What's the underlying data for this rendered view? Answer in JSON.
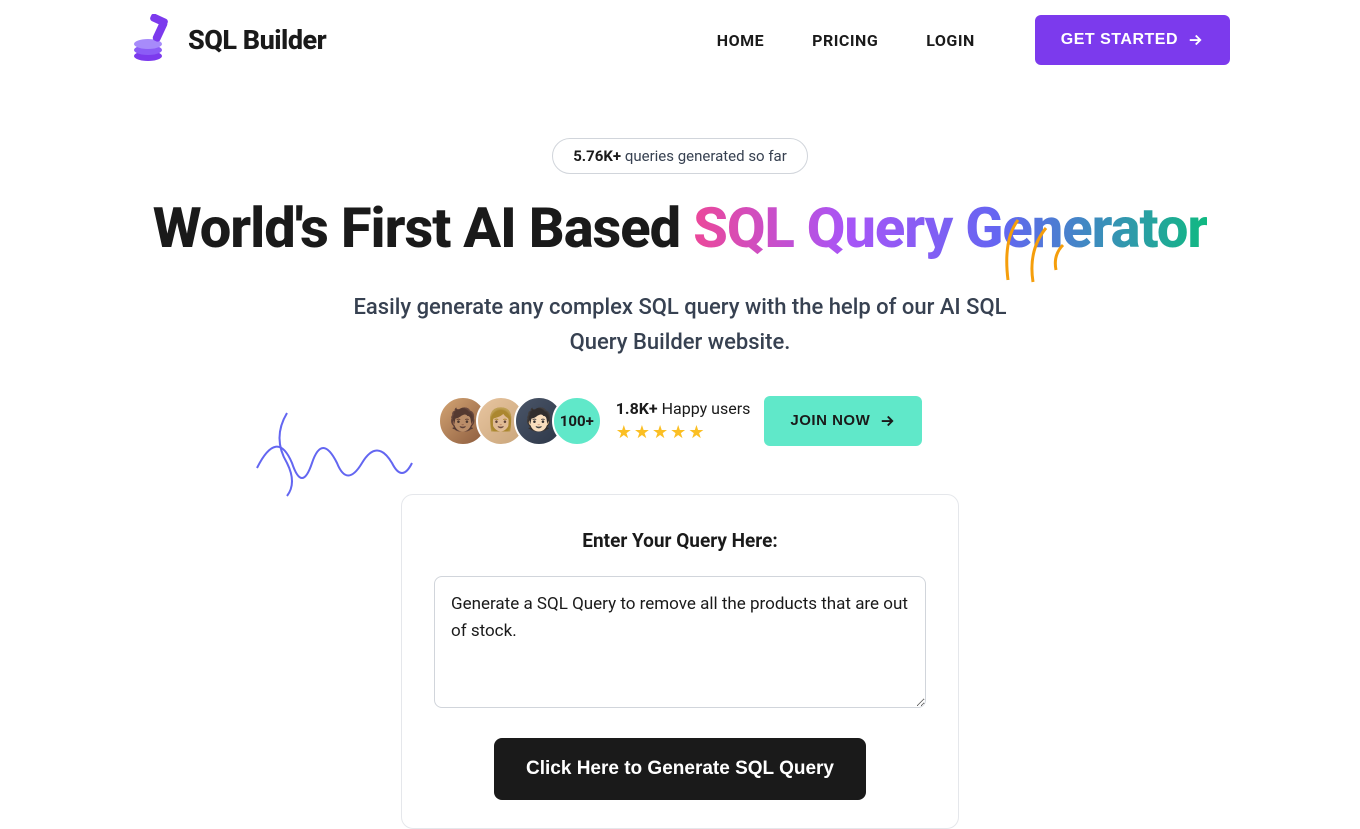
{
  "brand": {
    "name": "SQL Builder"
  },
  "nav": {
    "home": "HOME",
    "pricing": "PRICING",
    "login": "LOGIN",
    "get_started": "GET STARTED"
  },
  "hero": {
    "queries_count": "5.76K+",
    "queries_text": " queries generated so far",
    "headline_plain": "World's First AI Based ",
    "headline_colored": "SQL Query Generator",
    "subtext": "Easily generate any complex SQL query with the help of our AI SQL Query Builder website.",
    "avatar_count": "100+",
    "users_count": "1.8K+",
    "users_text": " Happy users",
    "join_now": "JOIN NOW"
  },
  "query": {
    "title": "Enter Your Query Here:",
    "value": "Generate a SQL Query to remove all the products that are out of stock.",
    "generate_label": "Click Here to Generate SQL Query"
  }
}
